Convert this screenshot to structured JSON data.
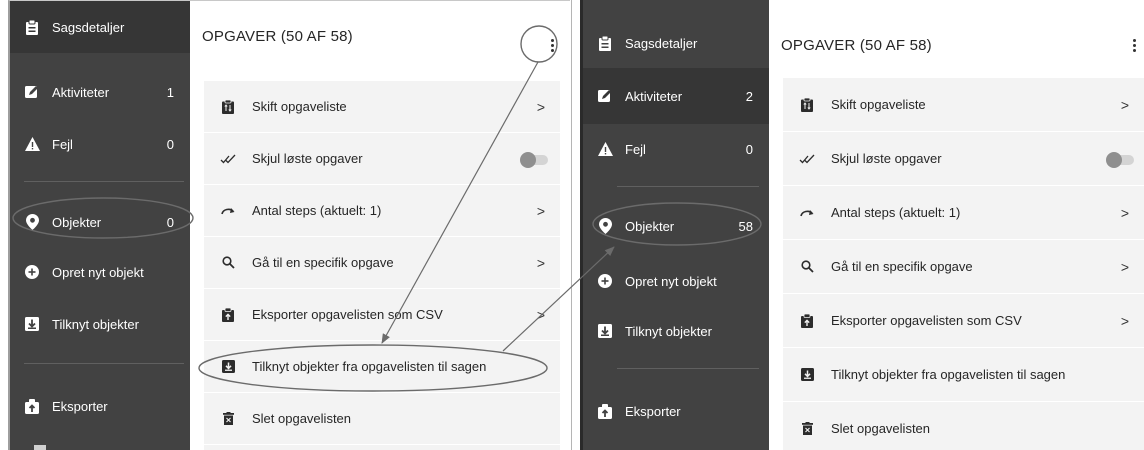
{
  "colors": {
    "sidebar_bg": "#424242",
    "sidebar_active": "#363636",
    "menu_bg": "#f3f3f3",
    "annotation": "#6b6b6b"
  },
  "left": {
    "sidebar": {
      "items": [
        {
          "label": "Sagsdetaljer",
          "icon": "clipboard-icon",
          "count": ""
        },
        {
          "label": "Aktiviteter",
          "icon": "edit-icon",
          "count": "1"
        },
        {
          "label": "Fejl",
          "icon": "warning-icon",
          "count": "0"
        },
        {
          "label": "Objekter",
          "icon": "location-pin-icon",
          "count": "0"
        },
        {
          "label": "Opret nyt objekt",
          "icon": "add-circle-icon",
          "count": ""
        },
        {
          "label": "Tilknyt objekter",
          "icon": "download-box-icon",
          "count": ""
        },
        {
          "label": "Eksporter",
          "icon": "export-icon",
          "count": ""
        }
      ]
    },
    "header": {
      "title": "OPGAVER (50 AF 58)",
      "menu_icon": "kebab-menu-icon"
    }
  },
  "right": {
    "sidebar": {
      "items": [
        {
          "label": "Sagsdetaljer",
          "icon": "clipboard-icon",
          "count": ""
        },
        {
          "label": "Aktiviteter",
          "icon": "edit-icon",
          "count": "2"
        },
        {
          "label": "Fejl",
          "icon": "warning-icon",
          "count": "0"
        },
        {
          "label": "Objekter",
          "icon": "location-pin-icon",
          "count": "58"
        },
        {
          "label": "Opret nyt objekt",
          "icon": "add-circle-icon",
          "count": ""
        },
        {
          "label": "Tilknyt objekter",
          "icon": "download-box-icon",
          "count": ""
        },
        {
          "label": "Eksporter",
          "icon": "export-icon",
          "count": ""
        }
      ]
    },
    "header": {
      "title": "OPGAVER (50 AF 58)",
      "menu_icon": "kebab-menu-icon"
    }
  },
  "menu": {
    "items": [
      {
        "label": "Skift opgaveliste",
        "icon": "switch-list-icon",
        "trailing": "chevron"
      },
      {
        "label": "Skjul løste opgaver",
        "icon": "double-check-icon",
        "trailing": "toggle",
        "toggle_on": false
      },
      {
        "label": "Antal steps (aktuelt: 1)",
        "icon": "redo-icon",
        "trailing": "chevron"
      },
      {
        "label": "Gå til en specifik opgave",
        "icon": "search-icon",
        "trailing": "chevron"
      },
      {
        "label": "Eksporter opgavelisten som CSV",
        "icon": "export-icon",
        "trailing": "chevron"
      },
      {
        "label": "Tilknyt objekter fra opgavelisten til sagen",
        "icon": "download-box-icon",
        "trailing": "none"
      },
      {
        "label": "Slet opgavelisten",
        "icon": "trash-icon",
        "trailing": "none"
      }
    ],
    "chevron_glyph": ">"
  }
}
